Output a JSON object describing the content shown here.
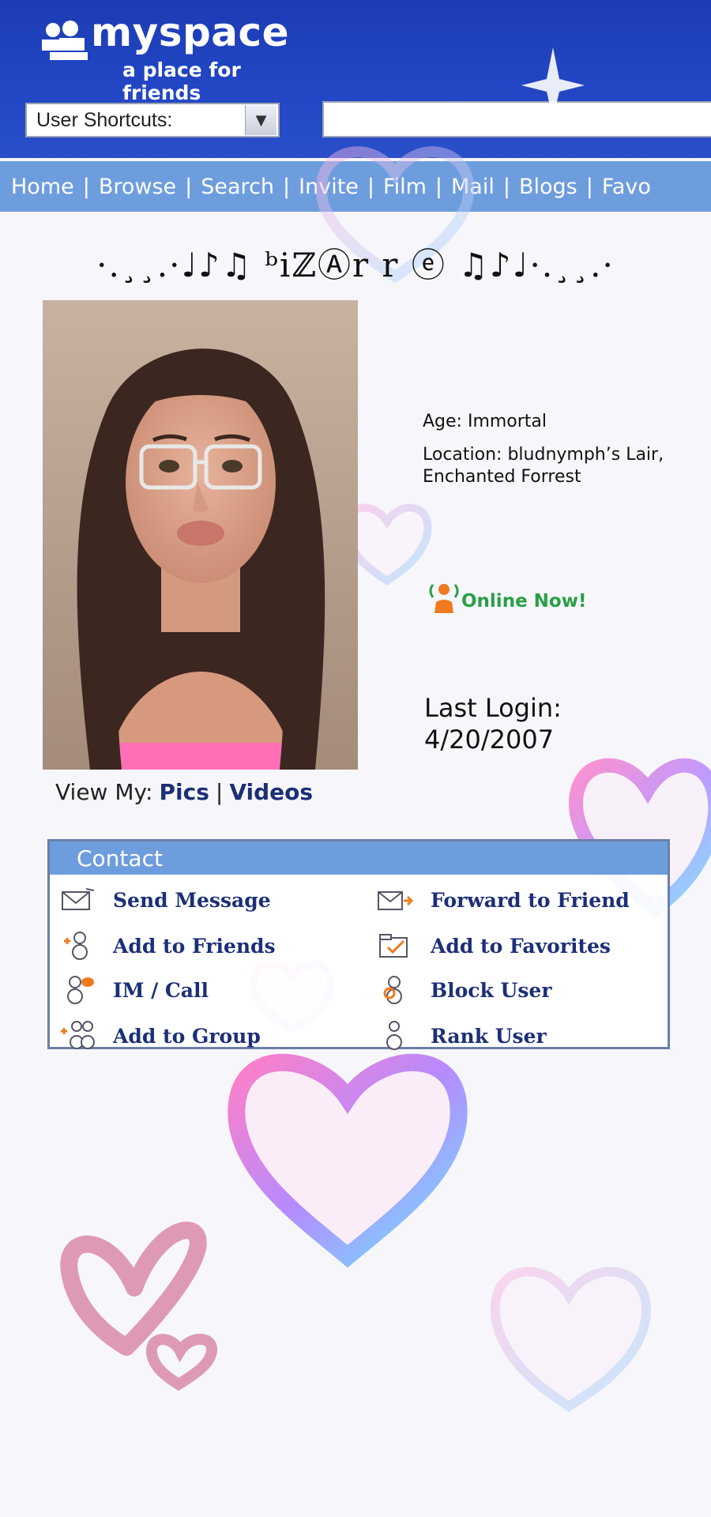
{
  "header": {
    "logo_word": "myspace",
    "logo_tagline": "a place for friends",
    "shortcuts_label": "User Shortcuts:"
  },
  "nav": {
    "items": [
      "Home",
      "Browse",
      "Search",
      "Invite",
      "Film",
      "Mail",
      "Blogs",
      "Favo"
    ]
  },
  "profile": {
    "name": "·.¸¸.·♩♪♫ ᵇiℤⒶr r ⓔ ♫♪♩·.¸¸.·",
    "age": "Age: Immortal",
    "location": "Location: bludnymph’s Lair, Enchanted Forrest",
    "online_status": "Online Now!",
    "last_login_label": "Last Login:",
    "last_login_date": "4/20/2007",
    "view_my_label": "View My:",
    "view_my_pics": "Pics",
    "view_my_sep": "|",
    "view_my_videos": "Videos"
  },
  "contact": {
    "title": "Contact",
    "items": [
      {
        "label": "Send Message",
        "icon": "envelope-icon"
      },
      {
        "label": "Forward to Friend",
        "icon": "forward-mail-icon"
      },
      {
        "label": "Add to Friends",
        "icon": "add-friend-icon"
      },
      {
        "label": "Add to Favorites",
        "icon": "favorites-icon"
      },
      {
        "label": "IM / Call",
        "icon": "im-call-icon"
      },
      {
        "label": "Block User",
        "icon": "block-user-icon"
      },
      {
        "label": "Add to Group",
        "icon": "add-group-icon"
      },
      {
        "label": "Rank User",
        "icon": "rank-user-icon"
      }
    ]
  },
  "colors": {
    "header_blue": "#2246c4",
    "nav_blue": "#6e9dde",
    "link_navy": "#1c2f78",
    "online_green": "#29a045"
  }
}
